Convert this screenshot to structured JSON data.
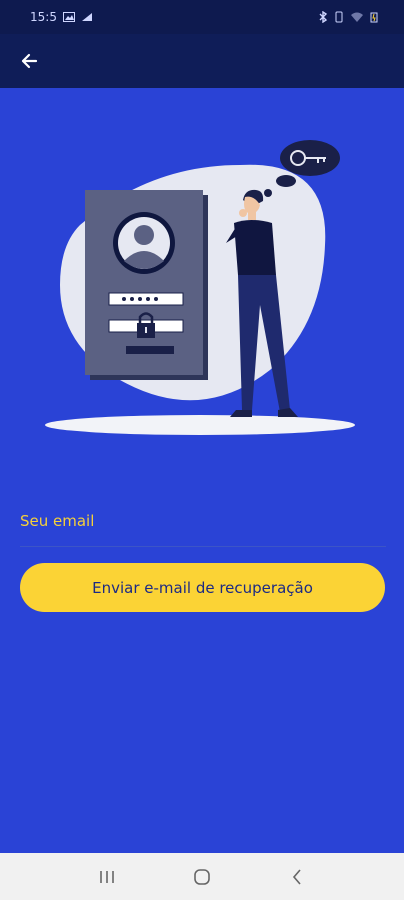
{
  "status_bar": {
    "time": "15:5",
    "icons_left": [
      "image-icon",
      "signal-icon"
    ],
    "icons_right": [
      "bluetooth-icon",
      "vibrate-icon",
      "wifi-icon",
      "battery-icon"
    ]
  },
  "app_bar": {
    "back_icon": "arrow-left-icon"
  },
  "illustration": {
    "description_icon": "forgot-password-illustration"
  },
  "form": {
    "email_label": "Seu email",
    "email_value": "",
    "submit_label": "Enviar e-mail de recuperação"
  },
  "nav_bar": {
    "recents_icon": "recents-icon",
    "home_icon": "home-icon",
    "back_icon": "back-chevron-icon"
  },
  "colors": {
    "background": "#2a43d6",
    "app_bar": "#0f1d58",
    "accent": "#fbd335",
    "button_text": "#1c2a84"
  }
}
